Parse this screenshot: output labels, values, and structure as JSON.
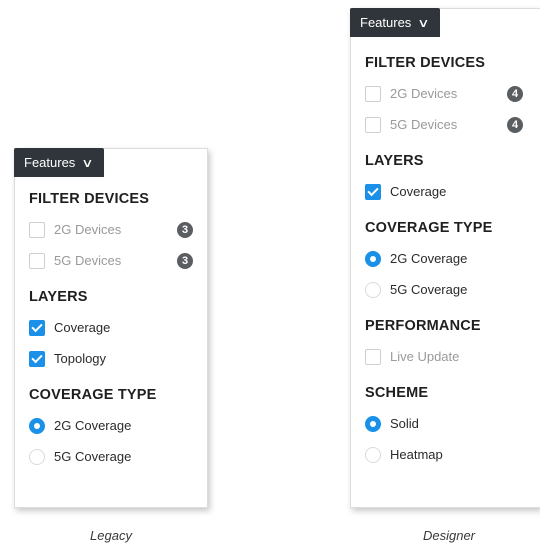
{
  "legacy": {
    "features_label": "Features",
    "filter_title": "FILTER DEVICES",
    "filters": [
      {
        "label": "2G Devices",
        "count": "3"
      },
      {
        "label": "5G Devices",
        "count": "3"
      }
    ],
    "layers_title": "LAYERS",
    "layers": [
      {
        "label": "Coverage",
        "checked": true
      },
      {
        "label": "Topology",
        "checked": true
      }
    ],
    "coverage_title": "COVERAGE TYPE",
    "coverage": [
      {
        "label": "2G Coverage",
        "selected": true
      },
      {
        "label": "5G Coverage",
        "selected": false
      }
    ],
    "caption": "Legacy"
  },
  "designer": {
    "features_label": "Features",
    "filter_title": "FILTER DEVICES",
    "filters": [
      {
        "label": "2G Devices",
        "count": "4"
      },
      {
        "label": "5G Devices",
        "count": "4"
      }
    ],
    "layers_title": "LAYERS",
    "layers": [
      {
        "label": "Coverage",
        "checked": true
      }
    ],
    "coverage_title": "COVERAGE TYPE",
    "coverage": [
      {
        "label": "2G Coverage",
        "selected": true
      },
      {
        "label": "5G Coverage",
        "selected": false
      }
    ],
    "performance_title": "PERFORMANCE",
    "performance": [
      {
        "label": "Live Update",
        "checked": false
      }
    ],
    "scheme_title": "SCHEME",
    "scheme": [
      {
        "label": "Solid",
        "selected": true
      },
      {
        "label": "Heatmap",
        "selected": false
      }
    ],
    "caption": "Designer"
  },
  "colors": {
    "accent": "#1a90e8",
    "button_bg": "#2f353a",
    "badge_bg": "#5b5e61"
  },
  "icons": {
    "dropdown": "chevron-down-icon",
    "check": "checkmark-icon"
  }
}
